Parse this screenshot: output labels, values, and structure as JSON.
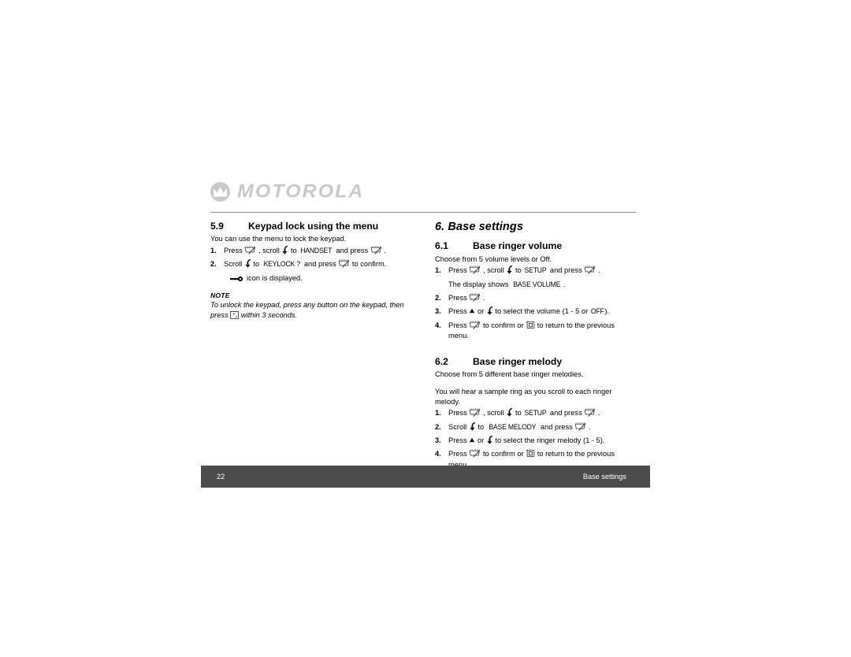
{
  "brand": {
    "logo_icon": "motorola-m-logo-icon",
    "wordmark": "MOTOROLA"
  },
  "left_column": {
    "section": {
      "number": "5.9",
      "title": "Keypad lock using the menu"
    },
    "intro": "You can use the menu to lock the keypad.",
    "steps": [
      {
        "n": "1.",
        "parts": [
          {
            "t": "text",
            "v": "Press "
          },
          {
            "t": "icon",
            "v": "select-key-icon"
          },
          {
            "t": "text",
            "v": " , scroll "
          },
          {
            "t": "icon",
            "v": "scroll-down-key-icon"
          },
          {
            "t": "text",
            "v": " to "
          },
          {
            "t": "lcd",
            "v": "HANDSET"
          },
          {
            "t": "text",
            "v": " and press "
          },
          {
            "t": "icon",
            "v": "select-key-icon"
          },
          {
            "t": "text",
            "v": " ."
          }
        ]
      },
      {
        "n": "2.",
        "parts": [
          {
            "t": "text",
            "v": "Scroll "
          },
          {
            "t": "icon",
            "v": "scroll-down-key-icon"
          },
          {
            "t": "text",
            "v": " to "
          },
          {
            "t": "lcd",
            "v": "KEYLOCK ?"
          },
          {
            "t": "text",
            "v": " and press "
          },
          {
            "t": "icon",
            "v": "select-key-icon"
          },
          {
            "t": "text",
            "v": " to confirm."
          }
        ]
      }
    ],
    "keylock_note": {
      "icon": "key-lock-icon",
      "text": "icon is displayed."
    },
    "note": {
      "label": "NOTE",
      "line1": "To unlock the keypad, press any button on the keypad, then",
      "line2_before": "press ",
      "line2_icon": "star-key-icon",
      "line2_after": " within 3 seconds."
    }
  },
  "right_column": {
    "chapter": "6. Base settings",
    "sections": [
      {
        "number": "6.1",
        "title": "Base ringer volume",
        "intro": "Choose from 5 volume levels or Off.",
        "steps": [
          {
            "n": "1.",
            "parts": [
              {
                "t": "text",
                "v": "Press "
              },
              {
                "t": "icon",
                "v": "select-key-icon"
              },
              {
                "t": "text",
                "v": " , scroll "
              },
              {
                "t": "icon",
                "v": "scroll-down-key-icon"
              },
              {
                "t": "text",
                "v": " to "
              },
              {
                "t": "lcd",
                "v": "SETUP"
              },
              {
                "t": "text",
                "v": " and press "
              },
              {
                "t": "icon",
                "v": "select-key-icon"
              },
              {
                "t": "text",
                "v": " ."
              }
            ],
            "sub": [
              {
                "t": "text",
                "v": "The display shows "
              },
              {
                "t": "lcd",
                "v": "BASE VOLUME"
              },
              {
                "t": "text",
                "v": "."
              }
            ]
          },
          {
            "n": "2.",
            "parts": [
              {
                "t": "text",
                "v": "Press "
              },
              {
                "t": "icon",
                "v": "select-key-icon"
              },
              {
                "t": "text",
                "v": " ."
              }
            ]
          },
          {
            "n": "3.",
            "parts": [
              {
                "t": "text",
                "v": "Press "
              },
              {
                "t": "icon",
                "v": "scroll-up-key-icon"
              },
              {
                "t": "text",
                "v": " or "
              },
              {
                "t": "icon",
                "v": "scroll-down-key-icon"
              },
              {
                "t": "text",
                "v": " to select the volume (1 - 5 or "
              },
              {
                "t": "lcd",
                "v": "OFF"
              },
              {
                "t": "text",
                "v": ")."
              }
            ]
          },
          {
            "n": "4.",
            "parts": [
              {
                "t": "text",
                "v": "Press "
              },
              {
                "t": "icon",
                "v": "select-key-icon"
              },
              {
                "t": "text",
                "v": " to confirm or "
              },
              {
                "t": "icon",
                "v": "back-key-icon"
              },
              {
                "t": "text",
                "v": " to return to the previous menu."
              }
            ]
          }
        ]
      },
      {
        "number": "6.2",
        "title": "Base ringer melody",
        "intro": "Choose from 5 different base ringer melodies.",
        "intro2": "You will hear a sample ring as you scroll to each ringer melody.",
        "steps": [
          {
            "n": "1.",
            "parts": [
              {
                "t": "text",
                "v": "Press "
              },
              {
                "t": "icon",
                "v": "select-key-icon"
              },
              {
                "t": "text",
                "v": " , scroll "
              },
              {
                "t": "icon",
                "v": "scroll-down-key-icon"
              },
              {
                "t": "text",
                "v": " to "
              },
              {
                "t": "lcd",
                "v": "SETUP"
              },
              {
                "t": "text",
                "v": " and press "
              },
              {
                "t": "icon",
                "v": "select-key-icon"
              },
              {
                "t": "text",
                "v": " ."
              }
            ]
          },
          {
            "n": "2.",
            "parts": [
              {
                "t": "text",
                "v": "Scroll "
              },
              {
                "t": "icon",
                "v": "scroll-down-key-icon"
              },
              {
                "t": "text",
                "v": " to "
              },
              {
                "t": "lcd",
                "v": "BASE MELODY"
              },
              {
                "t": "text",
                "v": " and press "
              },
              {
                "t": "icon",
                "v": "select-key-icon"
              },
              {
                "t": "text",
                "v": " ."
              }
            ]
          },
          {
            "n": "3.",
            "parts": [
              {
                "t": "text",
                "v": "Press "
              },
              {
                "t": "icon",
                "v": "scroll-up-key-icon"
              },
              {
                "t": "text",
                "v": " or "
              },
              {
                "t": "icon",
                "v": "scroll-down-key-icon"
              },
              {
                "t": "text",
                "v": " to select the ringer melody (1 - 5)."
              }
            ]
          },
          {
            "n": "4.",
            "parts": [
              {
                "t": "text",
                "v": "Press "
              },
              {
                "t": "icon",
                "v": "select-key-icon"
              },
              {
                "t": "text",
                "v": " to confirm or "
              },
              {
                "t": "icon",
                "v": "back-key-icon"
              },
              {
                "t": "text",
                "v": " to return to the previous menu."
              }
            ]
          }
        ]
      }
    ]
  },
  "footer": {
    "page_number": "22",
    "section_name": "Base settings",
    "background": "#4b4b4b",
    "text_color": "#ffffff"
  },
  "colors": {
    "page_background": "#ffffff",
    "body_text": "#000000",
    "logo_gray": "#c9c9c9",
    "rule_gray": "#8d8d8d"
  }
}
